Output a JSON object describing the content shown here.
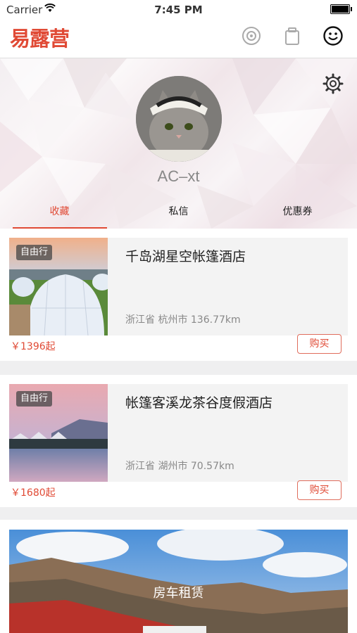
{
  "status_bar": {
    "carrier": "Carrier",
    "time": "7:45 PM"
  },
  "nav": {
    "logo": "易露营",
    "icons": [
      "compass-icon",
      "bag-icon",
      "smiley-icon"
    ]
  },
  "profile": {
    "username": "AC–xt",
    "tabs": [
      "收藏",
      "私信",
      "优惠券"
    ],
    "active_tab": 0
  },
  "favorites": [
    {
      "badge": "自由行",
      "title": "千岛湖星空帐篷酒店",
      "location": "浙江省 杭州市 136.77km",
      "price": "￥1396起",
      "buy": "购买"
    },
    {
      "badge": "自由行",
      "title": "帐篷客溪龙茶谷度假酒店",
      "location": "浙江省 湖州市 70.57km",
      "price": "￥1680起",
      "buy": "购买"
    }
  ],
  "banner": {
    "label": "房车租赁"
  },
  "colors": {
    "accent": "#e04a35"
  }
}
